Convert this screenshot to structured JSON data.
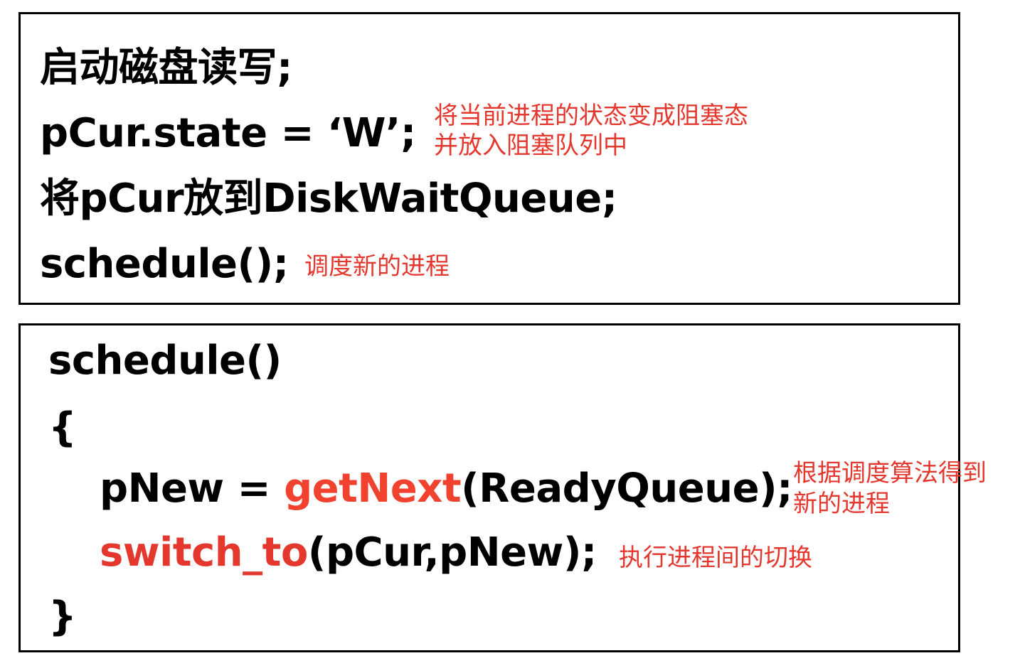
{
  "colors": {
    "text": "#000000",
    "annotation": "#e4382f",
    "highlight_getnext": "#f0422e",
    "highlight_switch": "#e4382f",
    "border": "#000000"
  },
  "top_box": {
    "line1": "启动磁盘读写;",
    "line2": "pCur.state = ‘W’;",
    "line3": "将pCur放到DiskWaitQueue;",
    "line4": "schedule();",
    "note_state_line1": "将当前进程的状态变成阻塞态",
    "note_state_line2": "并放入阻塞队列中",
    "note_schedule": "调度新的进程"
  },
  "bottom_box": {
    "line1": "schedule()",
    "brace_open": "{",
    "line3_prefix": "pNew = ",
    "line3_func": "getNext",
    "line3_suffix": "(ReadyQueue);",
    "line4_func": "switch_to",
    "line4_suffix": "(pCur,pNew);",
    "brace_close": "}",
    "note_getnext_line1": "根据调度算法得到",
    "note_getnext_line2": "新的进程",
    "note_switch": "执行进程间的切换"
  }
}
